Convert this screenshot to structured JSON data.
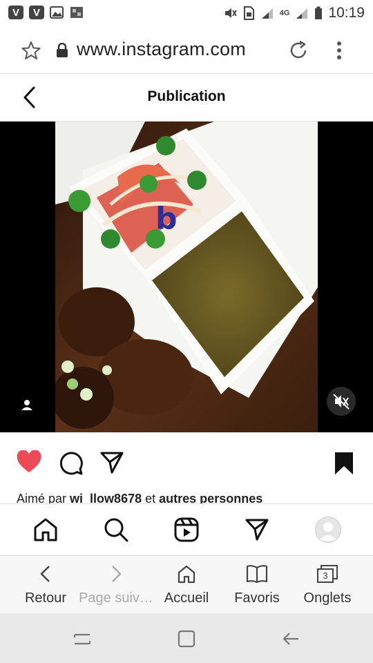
{
  "status_bar": {
    "time": "10:19",
    "network": "4G"
  },
  "browser": {
    "url": "www.instagram.com",
    "nav": [
      {
        "label": "Retour",
        "icon": "back-chevron-icon",
        "enabled": true
      },
      {
        "label": "Page suiv…",
        "icon": "forward-chevron-icon",
        "enabled": false
      },
      {
        "label": "Accueil",
        "icon": "home-icon",
        "enabled": true
      },
      {
        "label": "Favoris",
        "icon": "book-icon",
        "enabled": true
      },
      {
        "label": "Onglets",
        "icon": "tabs-icon",
        "enabled": true,
        "badge": "3"
      }
    ]
  },
  "header": {
    "title": "Publication"
  },
  "post": {
    "liked": true,
    "saved": true,
    "sound_muted": true,
    "watermark": "b",
    "likes_prefix": "Aimé par",
    "likes_user": "wi_llow8678",
    "likes_mid": "et",
    "likes_others": "autres personnes"
  },
  "colors": {
    "like": "#ed4956",
    "text": "#111111"
  }
}
